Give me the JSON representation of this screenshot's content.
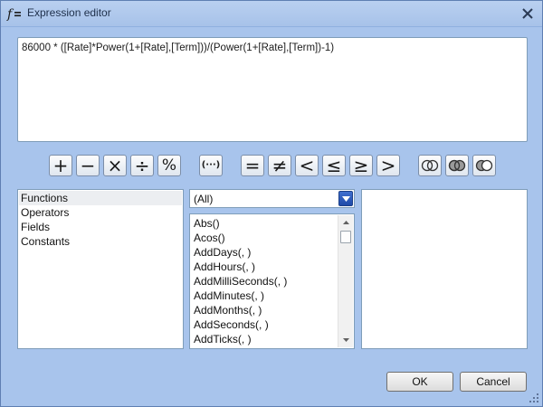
{
  "window": {
    "title": "Expression editor",
    "icon": "function-icon",
    "close": "close-icon"
  },
  "expression": {
    "value": "86000 * ([Rate]*Power(1+[Rate],[Term]))/(Power(1+[Rate],[Term])-1)"
  },
  "operators": [
    {
      "name": "plus",
      "glyph": "+"
    },
    {
      "name": "minus",
      "glyph": "−"
    },
    {
      "name": "multiply",
      "glyph": "×"
    },
    {
      "name": "divide",
      "glyph": "÷"
    },
    {
      "name": "modulo",
      "glyph": "%"
    },
    {
      "name": "parentheses",
      "glyph": "(···)"
    },
    {
      "name": "equal",
      "glyph": "="
    },
    {
      "name": "not-equal",
      "glyph": "≠"
    },
    {
      "name": "less",
      "glyph": "<"
    },
    {
      "name": "less-equal",
      "glyph": "≤"
    },
    {
      "name": "greater-equal",
      "glyph": "≥"
    },
    {
      "name": "greater",
      "glyph": ">"
    },
    {
      "name": "and",
      "glyph": "and-icon"
    },
    {
      "name": "or",
      "glyph": "or-icon"
    },
    {
      "name": "not",
      "glyph": "not-icon"
    }
  ],
  "categories": {
    "items": [
      "Functions",
      "Operators",
      "Fields",
      "Constants"
    ],
    "selected": "Functions"
  },
  "filter": {
    "selected": "(All)"
  },
  "functions": {
    "items": [
      "Abs()",
      "Acos()",
      "AddDays(, )",
      "AddHours(, )",
      "AddMilliSeconds(, )",
      "AddMinutes(, )",
      "AddMonths(, )",
      "AddSeconds(, )",
      "AddTicks(, )"
    ]
  },
  "buttons": {
    "ok": "OK",
    "cancel": "Cancel"
  }
}
